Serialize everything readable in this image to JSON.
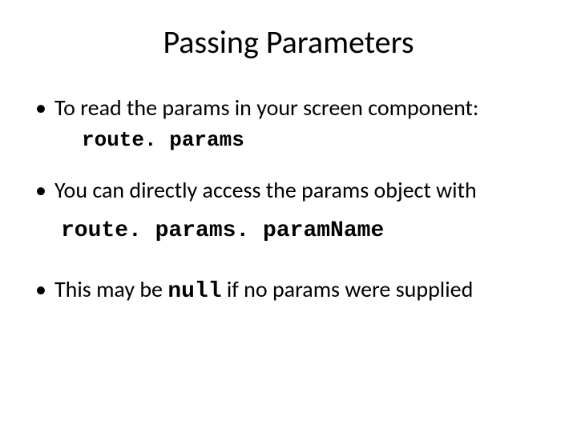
{
  "slide": {
    "title": "Passing Parameters",
    "bullet1": "To read the params in your screen component:",
    "code1": "route. params",
    "bullet2": "You can directly access the params object with",
    "code2": "route. params. paramName",
    "bullet3_pre": "This may be ",
    "bullet3_code": "null",
    "bullet3_post": " if no params were supplied"
  }
}
